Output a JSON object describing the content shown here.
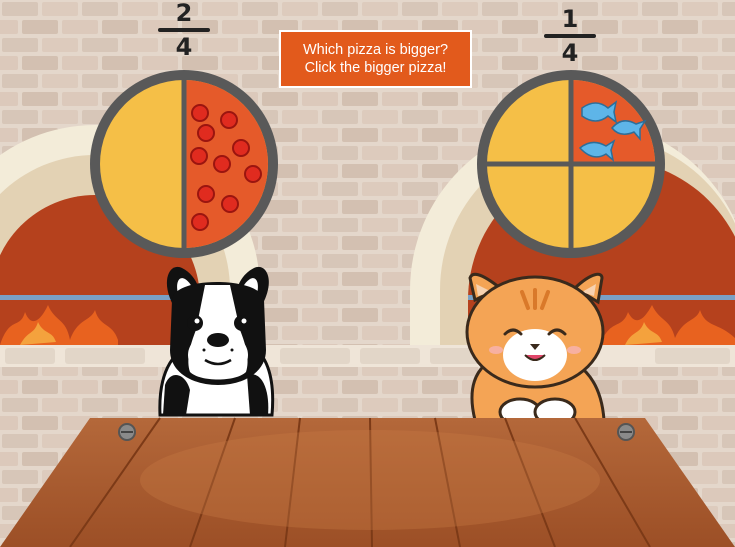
{
  "prompt": {
    "line1": "Which pizza is bigger?",
    "line2": "Click the bigger pizza!"
  },
  "left_pizza": {
    "fraction_numerator": "2",
    "fraction_denominator": "4",
    "topping": "pepperoni",
    "character": "dog"
  },
  "right_pizza": {
    "fraction_numerator": "1",
    "fraction_denominator": "4",
    "topping": "fish",
    "character": "cat"
  },
  "colors": {
    "prompt_bg": "#e25a1c",
    "pizza_cheese": "#f5bf47",
    "pizza_sauce": "#e55a2a",
    "pizza_rim": "#5c5c5c",
    "pepperoni": "#e02b1f",
    "fish": "#5eb5e8",
    "oven_fire": "#c6381a",
    "table": "#a5572d"
  }
}
